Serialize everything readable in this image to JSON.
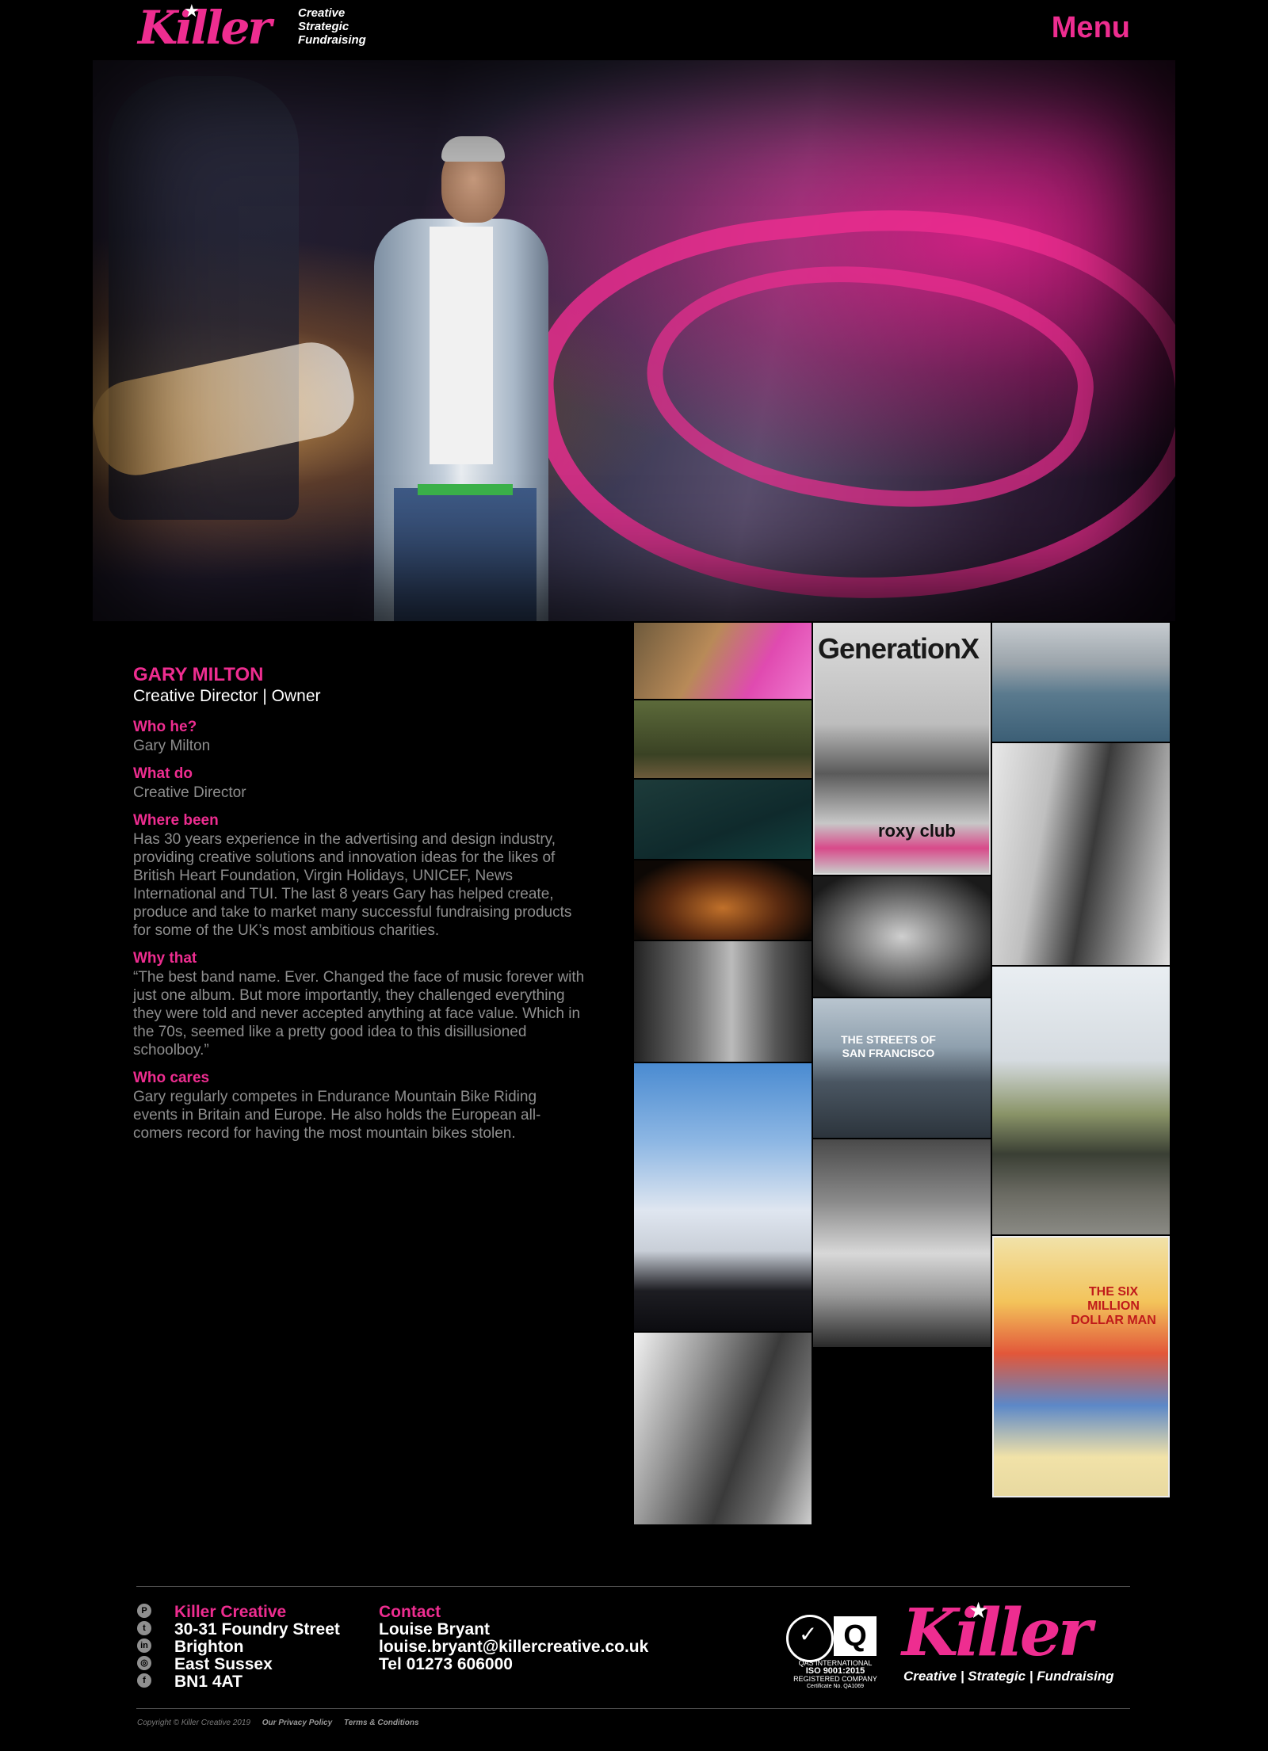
{
  "header": {
    "logo_word": "Killer",
    "logo_tag": [
      "Creative",
      "Strategic",
      "Fundraising"
    ],
    "menu_label": "Menu"
  },
  "bio": {
    "name": "GARY MILTON",
    "role": "Creative Director | Owner",
    "sections": [
      {
        "q": "Who he?",
        "a": "Gary Milton"
      },
      {
        "q": "What do",
        "a": "Creative Director"
      },
      {
        "q": "Where been",
        "a": "Has 30 years experience in the advertising and design industry, providing creative solutions and innovation ideas for the likes of British Heart Foundation, Virgin Holidays, UNICEF, News International and TUI. The last 8 years Gary has helped create, produce and take to market many successful fundraising products for some of the UK’s most ambitious charities."
      },
      {
        "q": "Why that",
        "a": "“The best band name. Ever. Changed the face of music forever with just one album. But more importantly, they challenged everything they were told and never accepted anything at face value. Which in the 70s, seemed like a pretty good idea to this disillusioned schoolboy.”"
      },
      {
        "q": "Who cares",
        "a": "Gary regularly competes in Endurance Mountain Bike Riding events in Britain and Europe. He also holds the European all-comers record for having the most mountain bikes stolen."
      }
    ]
  },
  "gallery": {
    "poster_title": "GenerationX",
    "poster_sub": "roxy club",
    "sf_caption": "THE STREETS OF SAN FRANCISCO",
    "comic_title": "THE SIX MILLION DOLLAR MAN"
  },
  "footer": {
    "company": "Killer Creative",
    "address": [
      "30-31 Foundry Street",
      "Brighton",
      "East Sussex",
      "BN1 4AT"
    ],
    "contact_title": "Contact",
    "contact_name": "Louise Bryant",
    "contact_email": "louise.bryant@killercreative.co.uk",
    "contact_tel": "Tel 01273 606000",
    "iso_text": [
      "QAS INTERNATIONAL",
      "ISO 9001:2015",
      "REGISTERED COMPANY",
      "Certificate No. QA1069"
    ],
    "logo_word": "Killer",
    "logo_tag": "Creative | Strategic | Fundraising",
    "copyright": "Copyright © Killer Creative 2019",
    "privacy": "Our Privacy Policy",
    "terms": "Terms & Conditions"
  },
  "icons": [
    "pinterest-icon",
    "twitter-icon",
    "linkedin-icon",
    "instagram-icon",
    "facebook-icon"
  ],
  "colors": {
    "accent": "#ee2d90",
    "background": "#000000",
    "muted_text": "#8e8e8e"
  }
}
